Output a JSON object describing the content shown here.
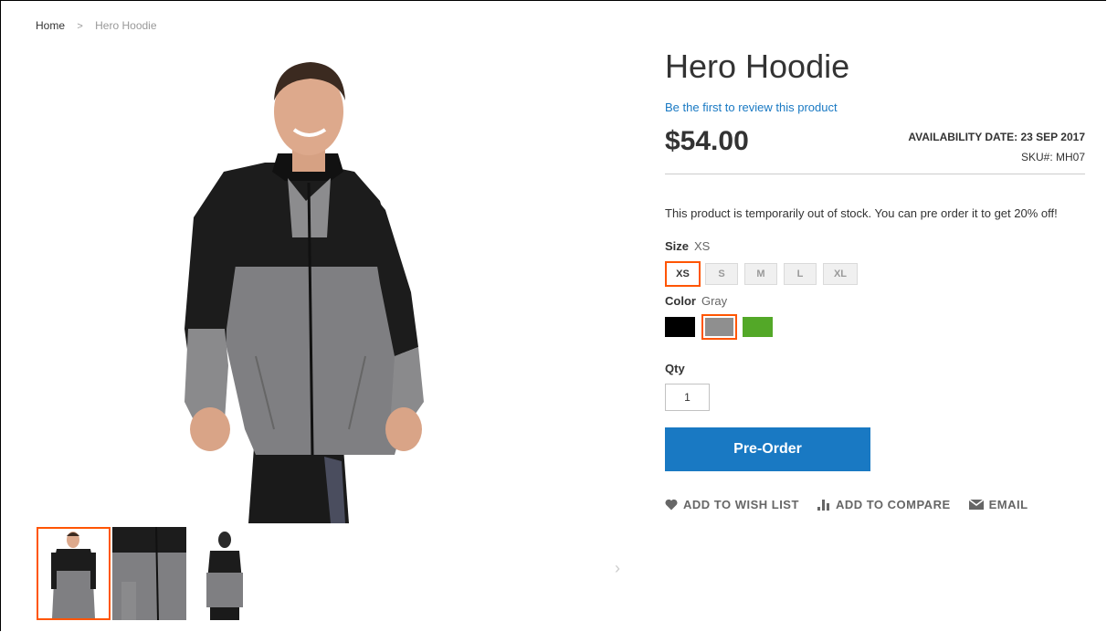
{
  "breadcrumb": {
    "home": "Home",
    "separator": ">",
    "current": "Hero Hoodie"
  },
  "product": {
    "title": "Hero Hoodie",
    "review_link": "Be the first to review this product",
    "price": "$54.00",
    "availability": "AVAILABILITY DATE: 23 SEP 2017",
    "sku": "SKU#:  MH07",
    "stock_message": "This product is temporarily out of stock. You can pre order it to get 20% off!"
  },
  "size": {
    "label": "Size",
    "selected": "XS",
    "options": [
      "XS",
      "S",
      "M",
      "L",
      "XL"
    ]
  },
  "color": {
    "label": "Color",
    "selected": "Gray",
    "swatches": [
      {
        "name": "Black",
        "hex": "#000000"
      },
      {
        "name": "Gray",
        "hex": "#8f8f8f"
      },
      {
        "name": "Green",
        "hex": "#53a828"
      }
    ]
  },
  "qty": {
    "label": "Qty",
    "value": "1"
  },
  "preorder_label": "Pre-Order",
  "actions": {
    "wishlist": "ADD TO WISH LIST",
    "compare": "ADD TO COMPARE",
    "email": "EMAIL"
  },
  "colors": {
    "accent": "#1979c3",
    "selected_outline": "#ff5501"
  }
}
